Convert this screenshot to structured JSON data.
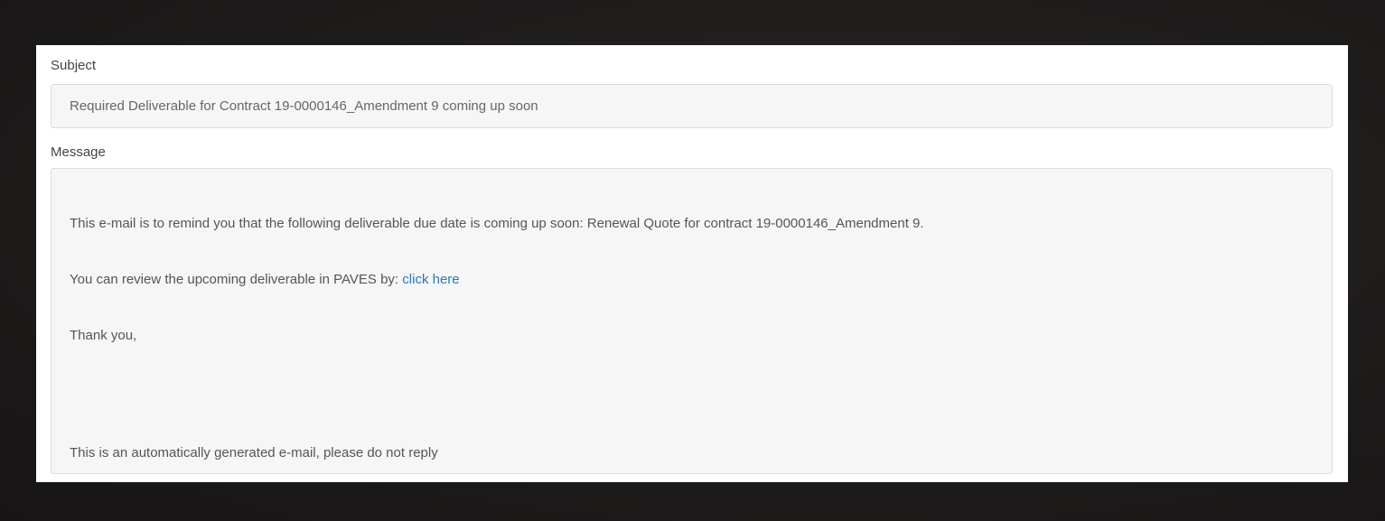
{
  "email": {
    "subject_label": "Subject",
    "subject_value": "Required Deliverable for Contract 19-0000146_Amendment 9 coming up soon",
    "message_label": "Message",
    "message": {
      "line1": "This e-mail is to remind you that the following deliverable due date is coming up soon: Renewal Quote for contract 19-0000146_Amendment 9.",
      "line2_prefix": "You can review the upcoming deliverable in PAVES by:",
      "line2_link": "click here",
      "line3": "Thank you,",
      "line4": "This is an automatically generated e-mail, please do not reply"
    }
  },
  "colors": {
    "background": "#1c1a19",
    "panel": "#ffffff",
    "field_background": "#f6f6f6",
    "link": "#2a7ab8"
  }
}
